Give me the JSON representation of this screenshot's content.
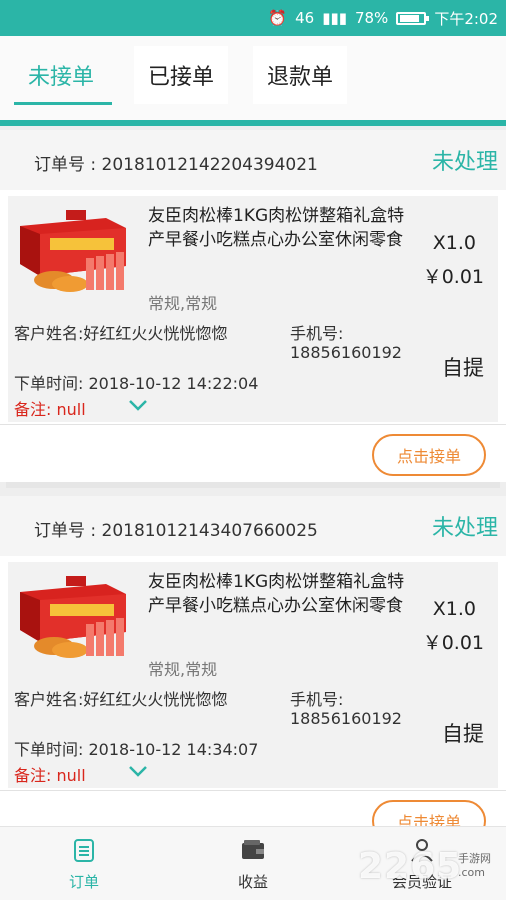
{
  "status_bar": {
    "battery": "78%",
    "time": "下午2:02",
    "signal_a": "46",
    "signal_b": "4G"
  },
  "tabs": [
    {
      "label": "未接单"
    },
    {
      "label": "已接单"
    },
    {
      "label": "退款单"
    }
  ],
  "labels": {
    "order_no_prefix": "订单号 : ",
    "customer_prefix": "客户姓名:",
    "phone_prefix": "手机号:",
    "time_prefix": "下单时间:  ",
    "remark_prefix": "备注:  ",
    "accept": "点击接单",
    "pickup": "自提"
  },
  "orders": [
    {
      "order_no_line": "订单号 : 20181012142204394021",
      "status": "未处理",
      "product_name": "友臣肉松棒1KG肉松饼整箱礼盒特产早餐小吃糕点心办公室休闲零食",
      "spec": "常规,常规",
      "qty": "X1.0",
      "price": "￥0.01",
      "customer_line": "客户姓名:好红红火火恍恍惚惚",
      "phone_label": "手机号:",
      "phone": "18856160192",
      "delivery": "自提",
      "time_line": "下单时间:  2018-10-12 14:22:04",
      "remark_line": "备注:  null",
      "accept_label": "点击接单"
    },
    {
      "order_no_line": "订单号 : 20181012143407660025",
      "status": "未处理",
      "product_name": "友臣肉松棒1KG肉松饼整箱礼盒特产早餐小吃糕点心办公室休闲零食",
      "spec": "常规,常规",
      "qty": "X1.0",
      "price": "￥0.01",
      "customer_line": "客户姓名:好红红火火恍恍惚惚",
      "phone_label": "手机号:",
      "phone": "18856160192",
      "delivery": "自提",
      "time_line": "下单时间:  2018-10-12 14:34:07",
      "remark_line": "备注:  null",
      "accept_label": "点击接单"
    }
  ],
  "bottom_nav": [
    {
      "label": "订单",
      "icon": "clipboard-icon"
    },
    {
      "label": "收益",
      "icon": "wallet-icon"
    },
    {
      "label": "会员验证",
      "icon": "user-icon"
    }
  ],
  "watermark": {
    "text": "2265",
    "sub_line1": "手游网",
    "sub_line2": ".com"
  },
  "colors": {
    "accent": "#2bb5a7",
    "orange": "#ee8a35",
    "remark_red": "#d9261c"
  }
}
